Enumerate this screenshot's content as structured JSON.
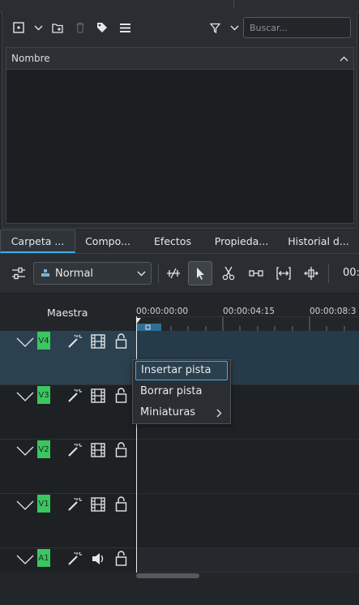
{
  "project_bin": {
    "search_placeholder": "Buscar...",
    "column_header": "Nombre",
    "toolbar_icons": [
      "add-clip-icon",
      "chevron-down-icon",
      "new-folder-icon",
      "delete-icon",
      "tag-icon",
      "menu-icon",
      "filter-icon",
      "chevron-down-icon"
    ]
  },
  "tabs": [
    {
      "label": "Carpeta ...",
      "active": true
    },
    {
      "label": "Compo...",
      "active": false
    },
    {
      "label": "Efectos",
      "active": false
    },
    {
      "label": "Propieda...",
      "active": false
    },
    {
      "label": "Historial d...",
      "active": false
    }
  ],
  "timeline_toolbar": {
    "mode": "Normal",
    "tools": [
      "timeline-settings-icon",
      "razor-spacer-icon",
      "select-tool-icon",
      "cut-tool-icon",
      "slip-tool-icon",
      "ripple-tool-icon",
      "spacer-tool-icon"
    ],
    "timecode_partial": "00:"
  },
  "timeline": {
    "master_label": "Maestra",
    "ruler_timecodes": [
      "00:00:00:00",
      "00:00:04:15",
      "00:00:08:3"
    ],
    "tracks": [
      {
        "name": "V4",
        "type": "video",
        "selected": true
      },
      {
        "name": "V3",
        "type": "video",
        "selected": false
      },
      {
        "name": "V2",
        "type": "video",
        "selected": false
      },
      {
        "name": "V1",
        "type": "video",
        "selected": false
      },
      {
        "name": "A1",
        "type": "audio",
        "selected": false
      }
    ]
  },
  "context_menu": {
    "items": [
      {
        "label": "Insertar pista",
        "highlighted": true
      },
      {
        "label": "Borrar pista",
        "highlighted": false
      },
      {
        "label": "Miniaturas",
        "submenu": true
      }
    ]
  },
  "colors": {
    "accent": "#3daee9",
    "track_badge": "#3ac660",
    "selected_track": "#2c4150"
  }
}
